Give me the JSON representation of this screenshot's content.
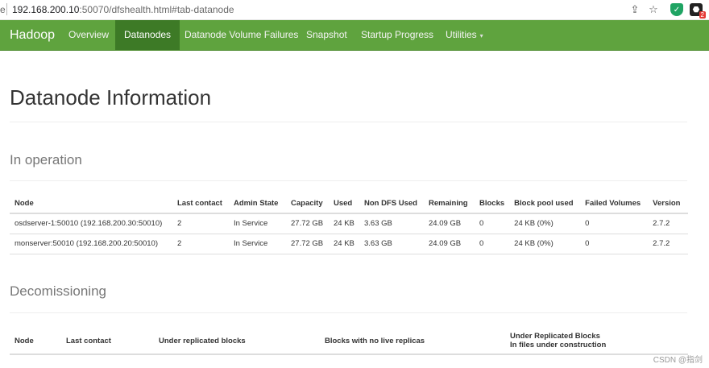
{
  "browser": {
    "edge_glyph": "e",
    "url_host": "192.168.200.10",
    "url_rest": ":50070/dfshealth.html#tab-datanode",
    "share_glyph": "⇪",
    "star_glyph": "☆",
    "shield_glyph": "✓",
    "ext_glyph": "⬣",
    "ext_badge": "2"
  },
  "navbar": {
    "brand": "Hadoop",
    "items": [
      {
        "label": "Overview"
      },
      {
        "label": "Datanodes"
      },
      {
        "label": "Datanode Volume Failures"
      },
      {
        "label": "Snapshot"
      },
      {
        "label": "Startup Progress"
      },
      {
        "label": "Utilities",
        "caret": "▾"
      }
    ],
    "active_color": "#3d7a26",
    "bar_color": "#5fa33e"
  },
  "page": {
    "title": "Datanode Information",
    "in_operation": {
      "title": "In operation",
      "columns": [
        "Node",
        "Last contact",
        "Admin State",
        "Capacity",
        "Used",
        "Non DFS Used",
        "Remaining",
        "Blocks",
        "Block pool used",
        "Failed Volumes",
        "Version"
      ],
      "rows": [
        [
          "osdserver-1:50010 (192.168.200.30:50010)",
          "2",
          "In Service",
          "27.72 GB",
          "24 KB",
          "3.63 GB",
          "24.09 GB",
          "0",
          "24 KB (0%)",
          "0",
          "2.7.2"
        ],
        [
          "monserver:50010 (192.168.200.20:50010)",
          "2",
          "In Service",
          "27.72 GB",
          "24 KB",
          "3.63 GB",
          "24.09 GB",
          "0",
          "24 KB (0%)",
          "0",
          "2.7.2"
        ]
      ]
    },
    "decommissioning": {
      "title": "Decomissioning",
      "columns": [
        "Node",
        "Last contact",
        "Under replicated blocks",
        "Blocks with no live replicas"
      ],
      "last_col_line1": "Under Replicated Blocks",
      "last_col_line2": "In files under construction"
    }
  },
  "watermark": "CSDN @指剑"
}
